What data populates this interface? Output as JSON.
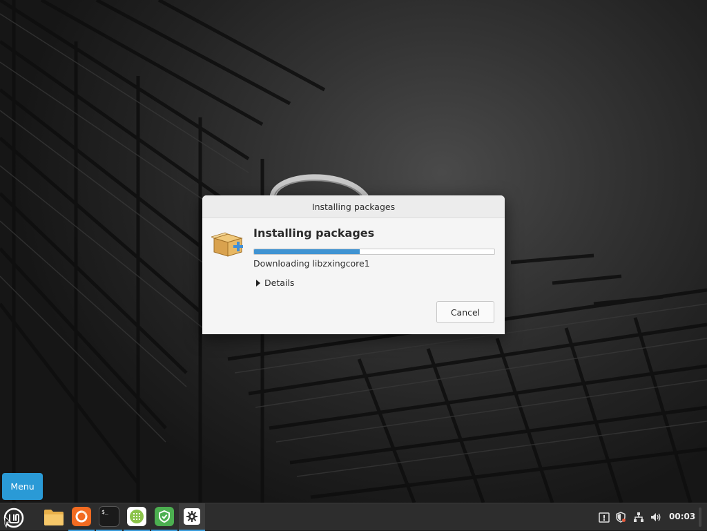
{
  "dialog": {
    "window_title": "Installing packages",
    "heading": "Installing packages",
    "progress_percent": 44,
    "status": "Downloading libzxingcore1",
    "details_label": "Details",
    "cancel_label": "Cancel"
  },
  "desktop": {
    "menu_label": "Menu"
  },
  "panel": {
    "launchers": [
      {
        "name": "files",
        "icon": "folder-icon"
      },
      {
        "name": "firefox",
        "icon": "firefox-icon"
      },
      {
        "name": "terminal",
        "icon": "terminal-icon",
        "glyph": "$_"
      },
      {
        "name": "software-manager",
        "icon": "software-grid-icon"
      },
      {
        "name": "update-manager",
        "icon": "shield-icon"
      },
      {
        "name": "settings",
        "icon": "gear-icon"
      }
    ],
    "tray_icons": [
      "update-notifier-icon",
      "security-shield-icon",
      "network-icon",
      "volume-icon"
    ],
    "clock": "00:03"
  },
  "colors": {
    "accent": "#3f93d2",
    "menu_button": "#2a9ad6",
    "firefox": "#f26b21",
    "software_manager": "#8bc34a",
    "update_manager": "#4caf50"
  }
}
